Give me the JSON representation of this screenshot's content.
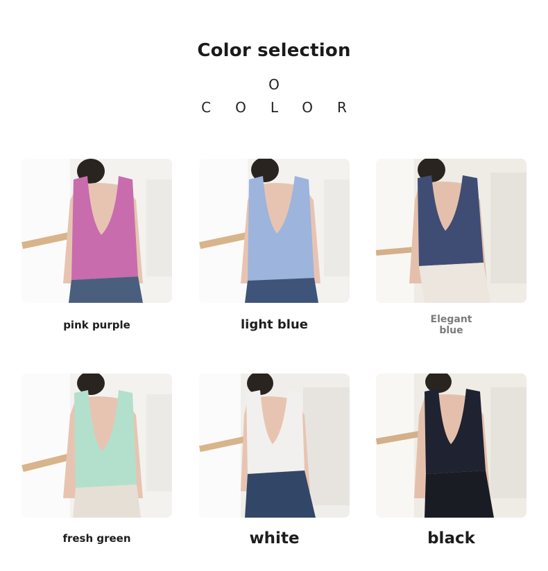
{
  "header": {
    "title": "Color selection",
    "subtitle_o": "O",
    "subtitle_color": "COLOR"
  },
  "colors": [
    {
      "label": "pink purple",
      "top_color": "#c86cae",
      "pants_color": "#4a5f7e"
    },
    {
      "label": "light blue",
      "top_color": "#9db4dc",
      "pants_color": "#3e5479"
    },
    {
      "label_line1": "Elegant",
      "label_line2": "blue",
      "top_color": "#3f4d75",
      "pants_color": "#ece6df"
    },
    {
      "label": "fresh green",
      "top_color": "#b2e0cc",
      "pants_color": "#e6dfd6"
    },
    {
      "label": "white",
      "top_color": "#f1f0ee",
      "pants_color": "#324768"
    },
    {
      "label": "black",
      "top_color": "#1f2230",
      "pants_color": "#1a1c24"
    }
  ]
}
